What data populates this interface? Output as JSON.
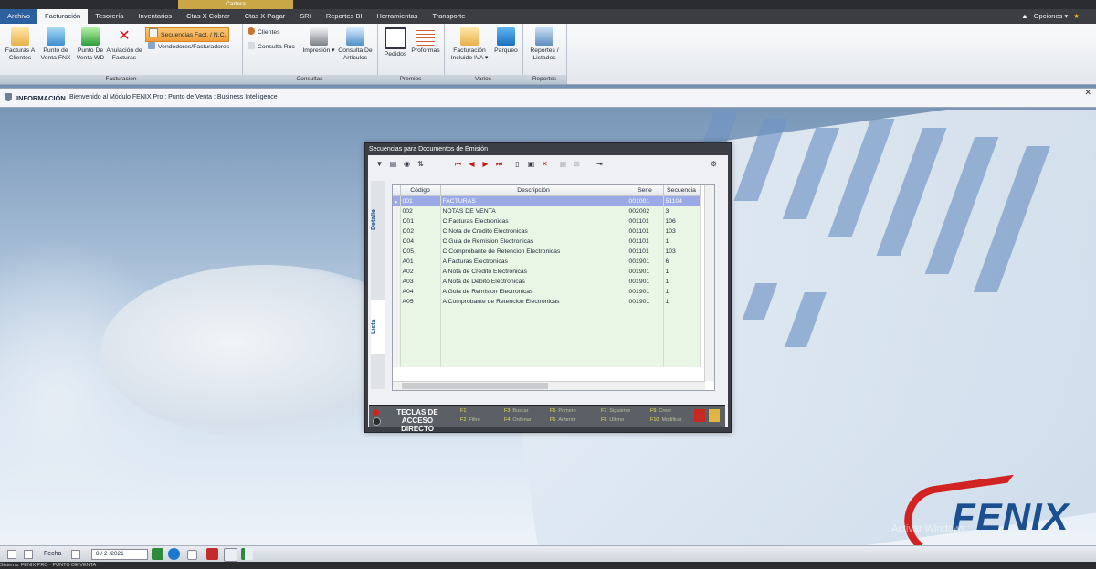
{
  "menu": {
    "context_group": "Cartera",
    "tabs": [
      "Archivo",
      "Facturación",
      "Tesorería",
      "Inventarios",
      "Ctas X Cobrar",
      "Ctas X Pagar",
      "SRI",
      "Reportes BI",
      "Herramientas",
      "Transporte"
    ],
    "active_tab": "Facturación",
    "options_label": "Opciones"
  },
  "ribbon": {
    "groups": [
      {
        "name": "Facturación",
        "buttons": [
          "Facturas A Clientes",
          "Punto de Venta FNX",
          "Punto De Venta WD",
          "Anulación de Facturas"
        ],
        "small": [
          "Secuencias Fact. / N.C.",
          "Vendedores/Facturadores"
        ]
      },
      {
        "name": "Consultas",
        "small": [
          "Clientes",
          "Consulta Ruc"
        ],
        "buttons": [
          "Impresión",
          "Consulta De Artículos"
        ]
      },
      {
        "name": "Premios",
        "buttons": [
          "Pedidos",
          "Proformas"
        ]
      },
      {
        "name": "Varios",
        "buttons": [
          "Facturación Incluido IVA",
          "Parqueo"
        ]
      },
      {
        "name": "Reportes",
        "buttons": [
          "Reportes / Listados"
        ]
      }
    ]
  },
  "info": {
    "label": "INFORMACIÓN",
    "message": "Bienvenido al Módulo FENIX Pro : Punto de Venta : Business Intelligence"
  },
  "dialog": {
    "title": "Secuencias para Documentos de Emisión",
    "tabs": [
      "Detalle",
      "Lista"
    ],
    "columns": [
      "Código",
      "Descripción",
      "Serie",
      "Secuencia"
    ],
    "rows": [
      [
        "001",
        "FACTURAS",
        "001001",
        "51104"
      ],
      [
        "002",
        "NOTAS DE VENTA",
        "002002",
        "3"
      ],
      [
        "C01",
        "C Facturas Electronicas",
        "001101",
        "106"
      ],
      [
        "C02",
        "C Nota de Credito Electronicas",
        "001101",
        "103"
      ],
      [
        "C04",
        "C Guia de Remision Electronicas",
        "001101",
        "1"
      ],
      [
        "C05",
        "C Comprobante de Retencion Electronicas",
        "001101",
        "103"
      ],
      [
        "A01",
        "A Facturas Electronicas",
        "001901",
        "6"
      ],
      [
        "A02",
        "A Nota de Credito Electronicas",
        "001901",
        "1"
      ],
      [
        "A03",
        "A Nota de Debito Electronicas",
        "001901",
        "1"
      ],
      [
        "A04",
        "A Guia de Remision Electronicas",
        "001901",
        "1"
      ],
      [
        "A05",
        "A Comprobante de Retencion Electronicas",
        "001901",
        "1"
      ]
    ],
    "selected_row": 0,
    "keys_title": "TECLAS DE ACCESO DIRECTO",
    "keys": [
      {
        "k": "F1",
        "d": ""
      },
      {
        "k": "F2",
        "d": "Filtro"
      },
      {
        "k": "F3",
        "d": "Buscar"
      },
      {
        "k": "F4",
        "d": "Ordenar"
      },
      {
        "k": "F5",
        "d": "Primero"
      },
      {
        "k": "F6",
        "d": "Anterior"
      },
      {
        "k": "F7",
        "d": "Siguiente"
      },
      {
        "k": "F8",
        "d": "Ultimo"
      },
      {
        "k": "F9",
        "d": "Crear"
      },
      {
        "k": "F10",
        "d": "Modificar"
      }
    ]
  },
  "logo": {
    "text": "FENIX"
  },
  "watermark": "Activar Windows",
  "status": {
    "fecha_label": "Fecha",
    "date": "8 / 2 /2021"
  },
  "bottom": "Sistema: FENIX PRO · PUNTO DE VENTA"
}
